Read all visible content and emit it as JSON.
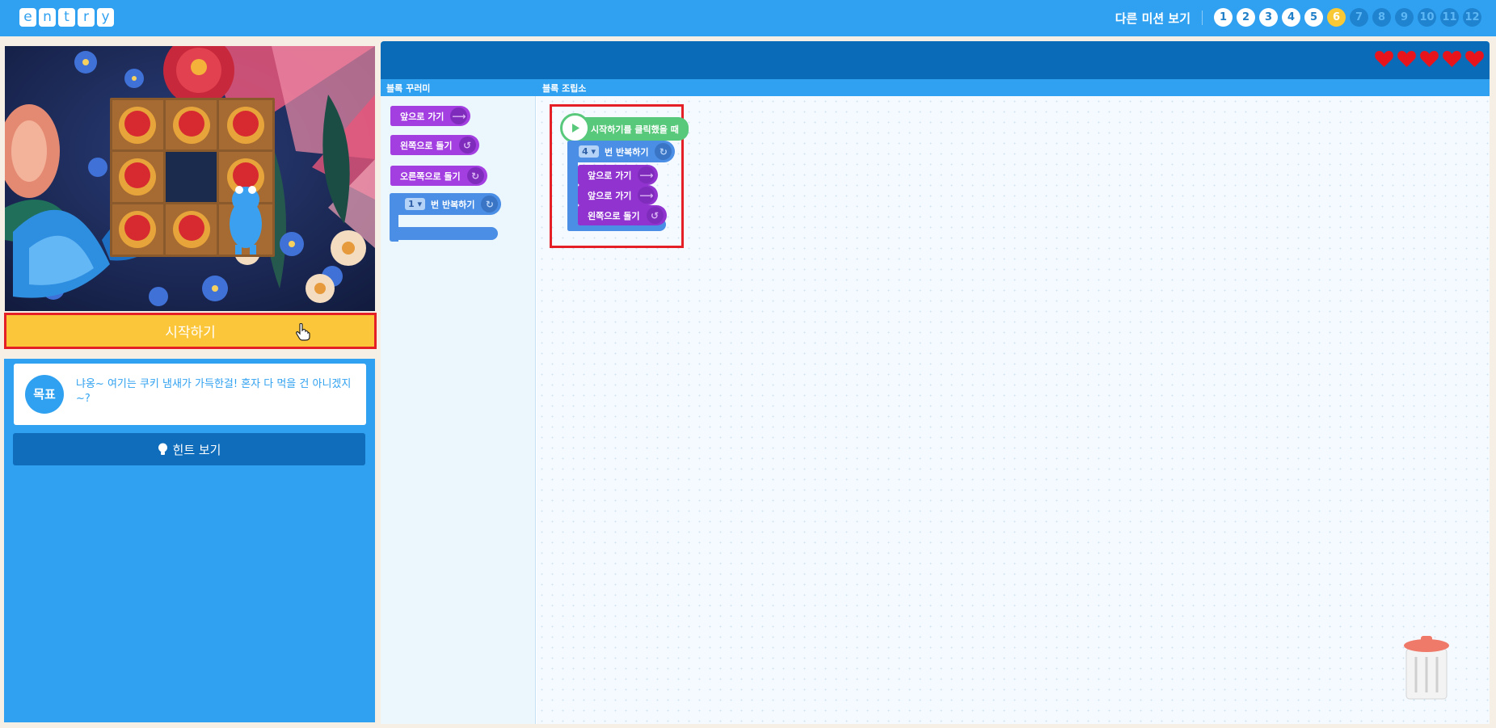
{
  "header": {
    "logo_letters": [
      "e",
      "n",
      "t",
      "r",
      "y"
    ],
    "other_missions": "다른 미션 보기",
    "stages": [
      "1",
      "2",
      "3",
      "4",
      "5",
      "6",
      "7",
      "8",
      "9",
      "10",
      "11",
      "12"
    ],
    "current_stage": 6
  },
  "player": {
    "start_label": "시작하기",
    "goal_badge": "목표",
    "goal_text": "냐옹~ 여기는 쿠키 냄새가 가득한걸! 혼자 다 먹을 건 아니겠지~?",
    "hint_label": "힌트 보기"
  },
  "workspace": {
    "palette_tab": "블록 꾸러미",
    "assembly_tab": "블록 조립소",
    "lives": 5
  },
  "palette": {
    "forward": "앞으로 가기",
    "turn_left": "왼쪽으로 돌기",
    "turn_right": "오른쪽으로 돌기",
    "repeat_count": "1",
    "repeat_label": "번 반복하기"
  },
  "program": {
    "start_block": "시작하기를 클릭했을 때",
    "repeat_count": "4",
    "repeat_label": "번 반복하기",
    "step1": "앞으로 가기",
    "step2": "앞으로 가기",
    "step3": "왼쪽으로 돌기"
  },
  "colors": {
    "brand_blue": "#30a1f0",
    "header_dark": "#0a6cb8",
    "start_yellow": "#fcc63a",
    "highlight_red": "#e42026",
    "block_purple": "#a33fe0",
    "block_blue": "#4a8ee5",
    "block_green": "#58c87a"
  }
}
